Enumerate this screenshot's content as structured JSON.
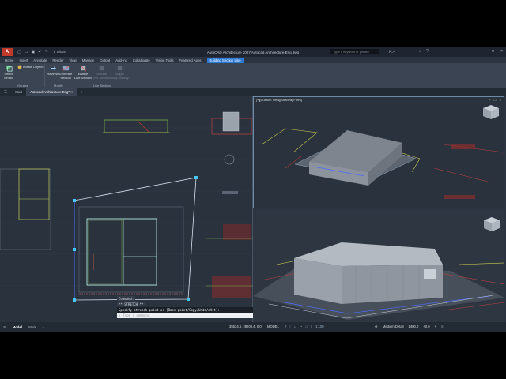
{
  "title_bar": {
    "app_letter": "A",
    "share_label": "Share",
    "title": "AutoCAD Architecture 2027   Autocad Architecture.Eng.dwg",
    "search_placeholder": "Type a keyword or phrase",
    "user": "jb_d"
  },
  "ribbon_tabs": [
    "Home",
    "Insert",
    "Annotate",
    "Render",
    "View",
    "Manage",
    "Output",
    "Add-ins",
    "Collaborate",
    "Vision Tools",
    "Featured Apps",
    "Building Section Line"
  ],
  "ribbon": {
    "select_similar": "Select\nSimilar",
    "isolate_objects": "Isolate Objects",
    "reverse": "Reverse",
    "generate_section": "Generate\nSection",
    "enable_live_section": "Enable\nLive Section",
    "exclude_live_section": "Exclude\nLive Section",
    "toggle_body_display": "Toggle\nBody Display",
    "group_general": "General",
    "group_modify": "Modify",
    "group_live_section": "Live Section"
  },
  "doc_tabs": {
    "start": "Start",
    "active": "Autocad Architecture.Eng*",
    "add": "+"
  },
  "viewports": {
    "top_label": "[+][Custom View][Shaded] Form]",
    "ctrl_min": "–",
    "ctrl_max": "□",
    "ctrl_close": "×"
  },
  "command_line": {
    "history_1": "Command:",
    "history_2": "** STRETCH **",
    "prompt": "Specify stretch point or [Base point/Copy/Undo/eXit]:",
    "input_placeholder": "Type a command"
  },
  "status_bar": {
    "model_tab": "Model",
    "work_tab": "Work",
    "add": "+",
    "coords": "35534.6, 28209.4, 0.0",
    "model": "MODEL",
    "scale": "1:100",
    "detail": "Medium Detail",
    "cut_plane": "1400.0",
    "elevation": "+0.0"
  },
  "colors": {
    "accent": "#2b7bd6",
    "canvas": "#2a323d",
    "ribbon": "#3a4452",
    "titlebar": "#1f2530"
  }
}
